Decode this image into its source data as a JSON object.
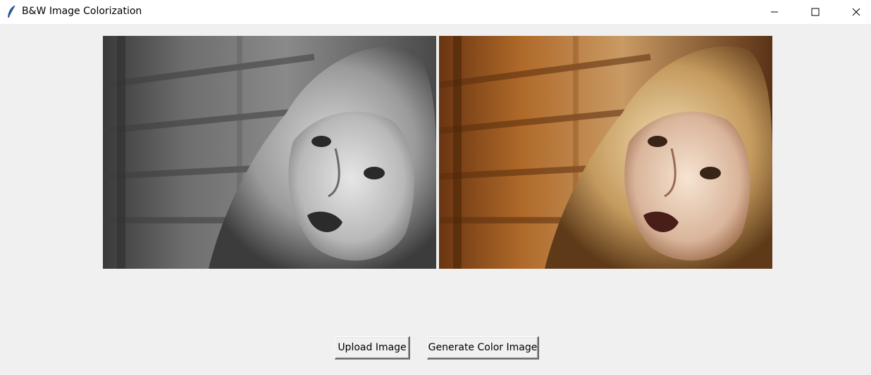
{
  "window": {
    "title": "B&W Image Colorization",
    "icon": "feather-icon",
    "controls": [
      "minimize-icon",
      "maximize-icon",
      "close-icon"
    ]
  },
  "images": {
    "original": {
      "mode": "grayscale"
    },
    "colorized": {
      "mode": "color",
      "tint": "#b06a2a"
    }
  },
  "buttons": {
    "upload_label": "Upload Image",
    "generate_label": "Generate Color Image"
  }
}
